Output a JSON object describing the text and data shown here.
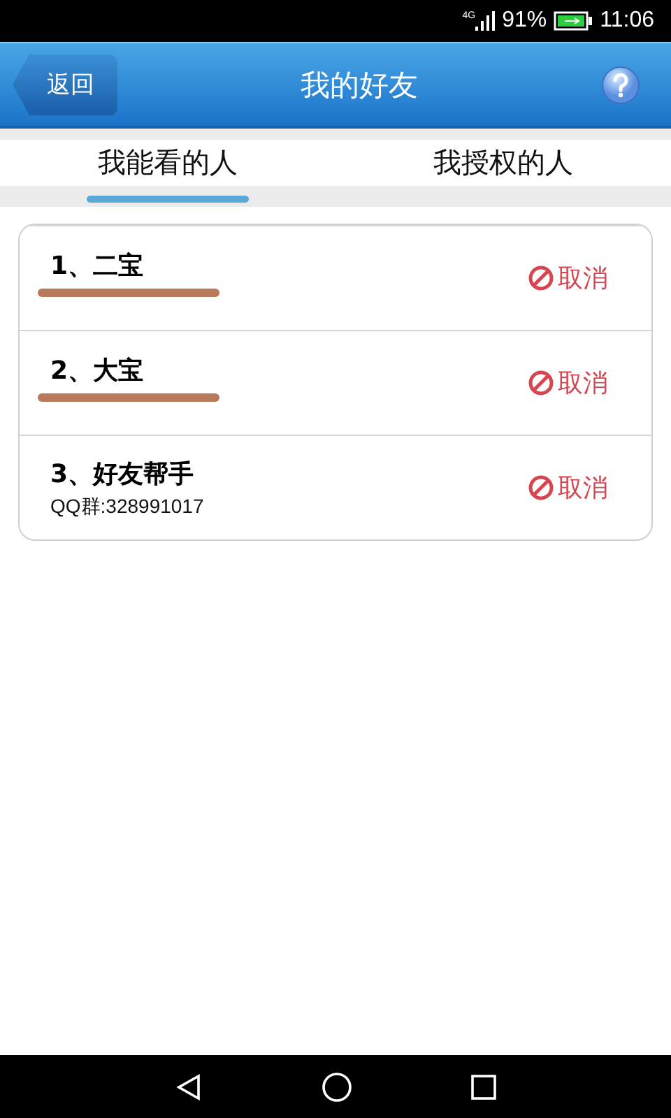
{
  "status_bar": {
    "network": "4G",
    "battery": "91%",
    "time": "11:06"
  },
  "header": {
    "back": "返回",
    "title": "我的好友"
  },
  "tabs": [
    {
      "label": "我能看的人",
      "selected": true
    },
    {
      "label": "我授权的人",
      "selected": false
    }
  ],
  "friends": [
    {
      "name": "1、二宝",
      "redacted": true,
      "action": "取消"
    },
    {
      "name": "2、大宝",
      "redacted": true,
      "action": "取消"
    },
    {
      "name": "3、好友帮手",
      "redacted": false,
      "detail": "QQ群:328991017",
      "action": "取消"
    }
  ]
}
